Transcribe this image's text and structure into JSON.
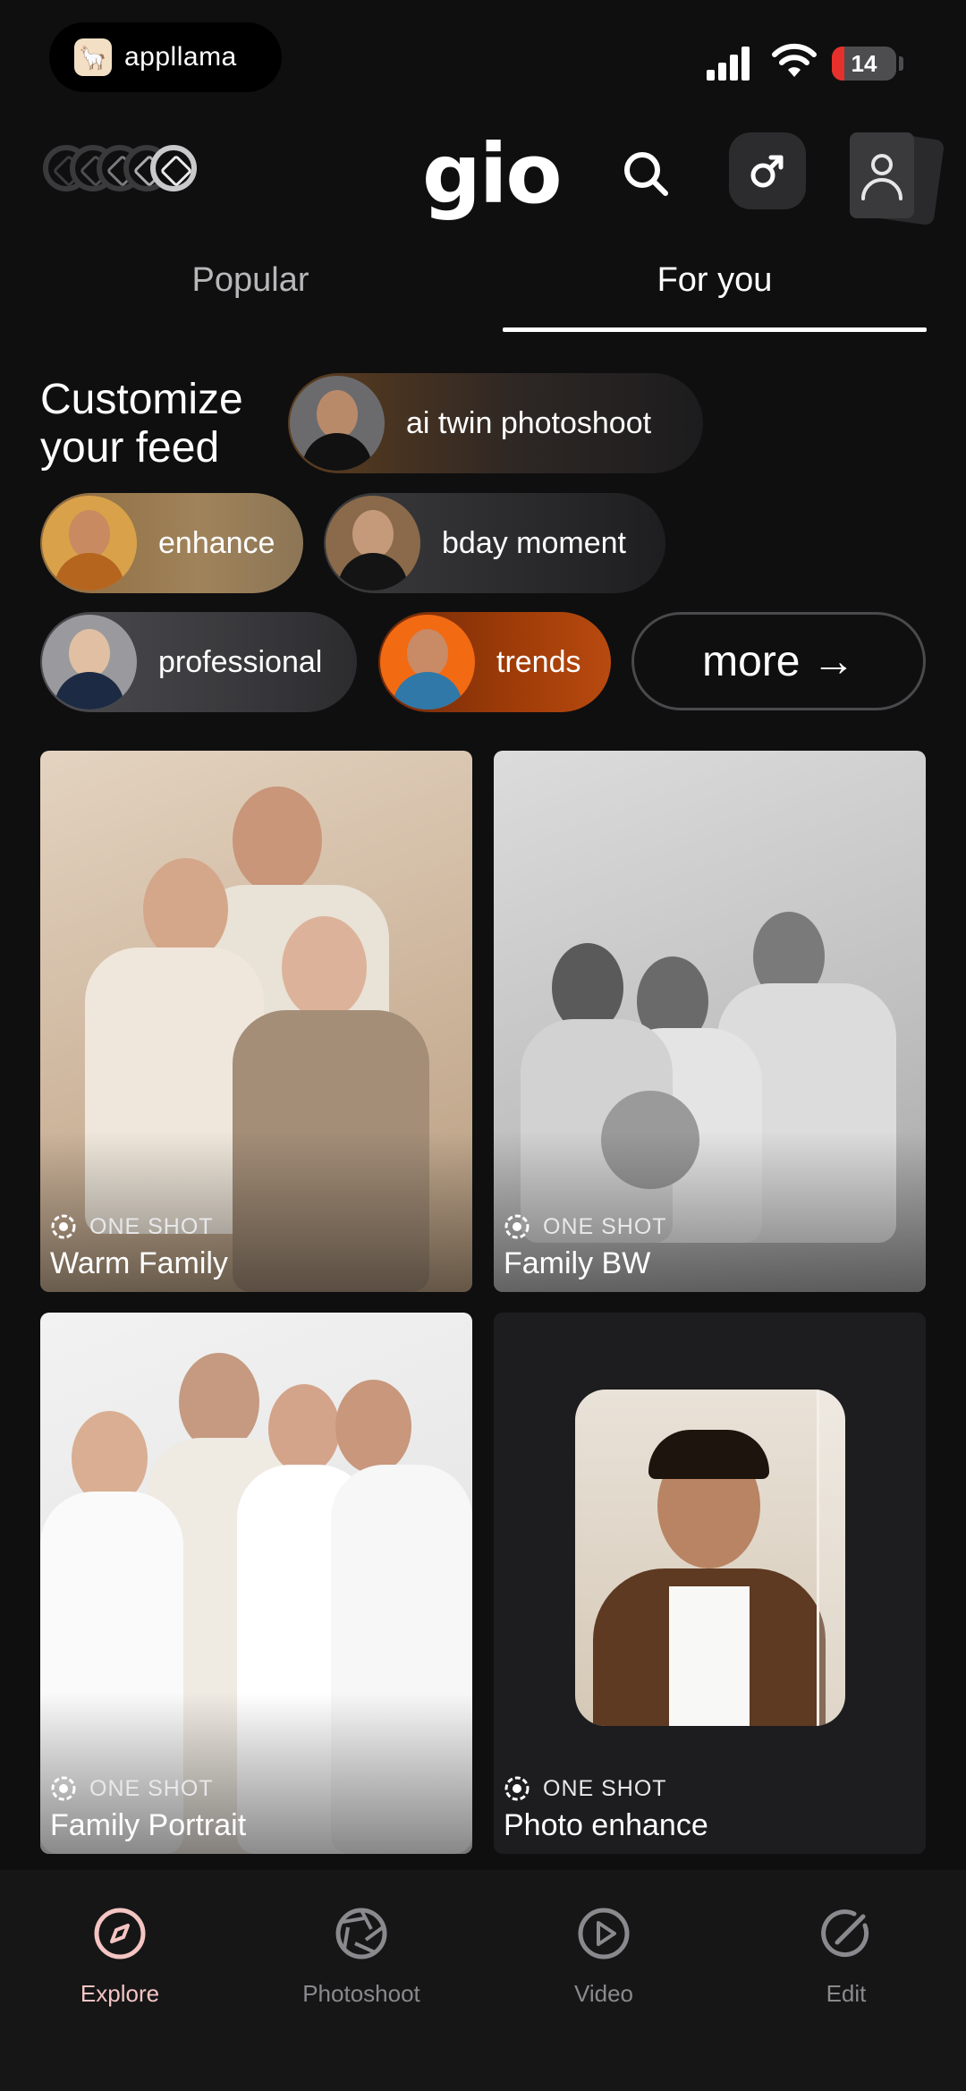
{
  "status_bar": {
    "app_name": "appllama",
    "battery_level": "14"
  },
  "header": {
    "logo": "gio",
    "search_icon": "search-icon",
    "gender_icon": "male-symbol-icon",
    "profile_icon": "profile-icon"
  },
  "tabs": [
    {
      "label": "Popular",
      "active": false
    },
    {
      "label": "For you",
      "active": true
    }
  ],
  "customize": {
    "title": "Customize your feed",
    "chips": [
      {
        "label": "ai twin photoshoot"
      },
      {
        "label": "enhance"
      },
      {
        "label": "bday moment"
      },
      {
        "label": "professional"
      },
      {
        "label": "trends"
      }
    ],
    "more_label": "more →"
  },
  "cards": [
    {
      "kind": "ONE SHOT",
      "title": "Warm Family"
    },
    {
      "kind": "ONE SHOT",
      "title": "Family BW"
    },
    {
      "kind": "ONE SHOT",
      "title": "Family Portrait"
    },
    {
      "kind": "ONE SHOT",
      "title": "Photo enhance"
    }
  ],
  "bottom_nav": [
    {
      "label": "Explore",
      "icon": "compass-icon",
      "active": true
    },
    {
      "label": "Photoshoot",
      "icon": "aperture-icon",
      "active": false
    },
    {
      "label": "Video",
      "icon": "play-icon",
      "active": false
    },
    {
      "label": "Edit",
      "icon": "edit-icon",
      "active": false
    }
  ],
  "colors": {
    "background": "#0f0f10",
    "active_nav": "#f4c5c2",
    "inactive_nav": "#8a8a8e"
  }
}
